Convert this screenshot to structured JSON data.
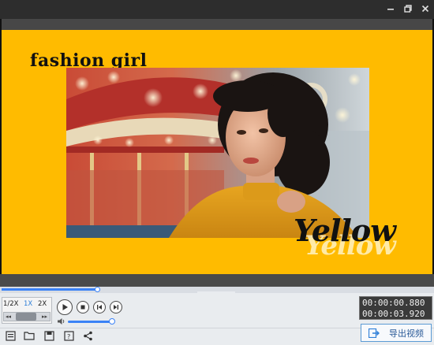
{
  "window": {
    "restore_glyph": "⧉",
    "close_glyph": "✕"
  },
  "preview": {
    "title_text": "fashion girl",
    "overlay_word": "Yellow",
    "overlay_word_shadow": "Yellow",
    "background_color": "#ffbb00"
  },
  "timeline": {
    "collapse_glyph": "⌄"
  },
  "speed": {
    "options": [
      "1/2X",
      "1X",
      "2X"
    ],
    "selected": "1X",
    "rewind_glyph": "◂◂",
    "forward_glyph": "▸▸"
  },
  "playback": {
    "current_time": "00:00:00.880",
    "total_time": "00:00:03.920"
  },
  "toolbar": {
    "icons": [
      "new-project-icon",
      "open-folder-icon",
      "save-icon",
      "save-as-icon",
      "share-icon"
    ],
    "export_label": "导出视频"
  }
}
